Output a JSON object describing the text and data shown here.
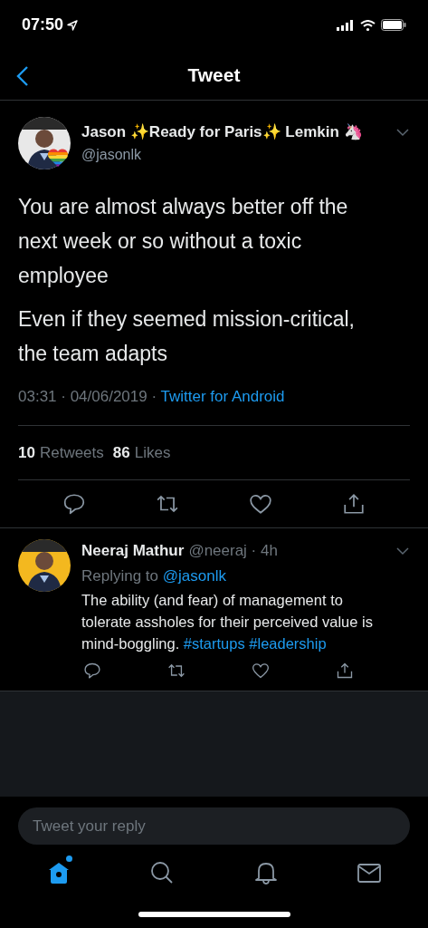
{
  "status_bar": {
    "time": "07:50"
  },
  "header": {
    "title": "Tweet"
  },
  "tweet": {
    "author": {
      "name": "Jason ✨Ready for Paris✨ Lemkin 🦄",
      "handle": "@jasonlk"
    },
    "paragraphs": [
      "You are almost always better off the next week or so without a toxic employee",
      "Even if they seemed mission-critical, the team adapts"
    ],
    "timestamp": "03:31 · 04/06/2019 · ",
    "source": "Twitter for Android",
    "stats": [
      {
        "count": "10",
        "label": "Retweets"
      },
      {
        "count": "86",
        "label": "Likes"
      }
    ]
  },
  "replies": [
    {
      "name": "Neeraj Mathur",
      "handle": "@neeraj · 4h",
      "replying_label": "Replying to ",
      "replying_to": "@jasonlk",
      "text": "The ability (and fear) of management to tolerate assholes for their perceived value is mind-boggling.",
      "hashtags": [
        "#startups",
        "#leadership"
      ]
    }
  ],
  "reply_field": {
    "placeholder": "Tweet your reply"
  },
  "tab_bar": [
    {
      "kind": "home",
      "selected": true,
      "badge": true
    },
    {
      "kind": "search",
      "selected": false,
      "badge": false
    },
    {
      "kind": "notifications",
      "selected": false,
      "badge": false
    },
    {
      "kind": "messages",
      "selected": false,
      "badge": false
    }
  ]
}
